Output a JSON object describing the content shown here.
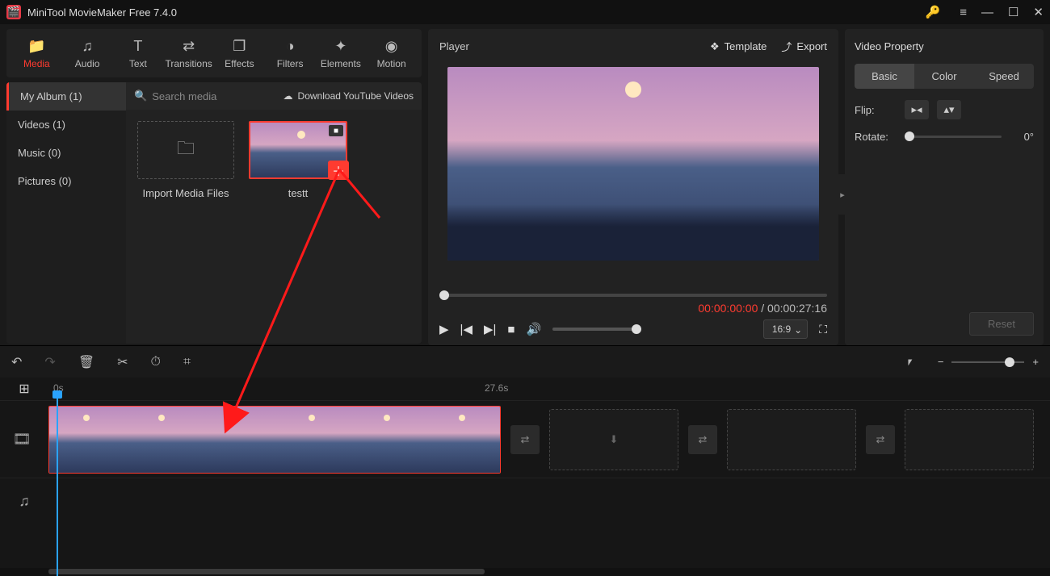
{
  "titlebar": {
    "title": "MiniTool MovieMaker Free 7.4.0"
  },
  "ribbon": [
    {
      "key": "media",
      "label": "Media",
      "glyph": "📁",
      "active": true
    },
    {
      "key": "audio",
      "label": "Audio",
      "glyph": "♫"
    },
    {
      "key": "text",
      "label": "Text",
      "glyph": "T"
    },
    {
      "key": "transitions",
      "label": "Transitions",
      "glyph": "⇄"
    },
    {
      "key": "effects",
      "label": "Effects",
      "glyph": "❐"
    },
    {
      "key": "filters",
      "label": "Filters",
      "glyph": "◑"
    },
    {
      "key": "elements",
      "label": "Elements",
      "glyph": "✦"
    },
    {
      "key": "motion",
      "label": "Motion",
      "glyph": "◉"
    }
  ],
  "media_nav": [
    {
      "label": "My Album (1)",
      "active": true
    },
    {
      "label": "Videos (1)"
    },
    {
      "label": "Music (0)"
    },
    {
      "label": "Pictures (0)"
    }
  ],
  "media_toolbar": {
    "search_placeholder": "Search media",
    "youtube_label": "Download YouTube Videos"
  },
  "import_label": "Import Media Files",
  "clip": {
    "name": "testt"
  },
  "player": {
    "title": "Player",
    "template_label": "Template",
    "export_label": "Export",
    "current_time": "00:00:00:00",
    "separator": " / ",
    "total_time": "00:00:27:16",
    "aspect_ratio": "16:9"
  },
  "props": {
    "title": "Video Property",
    "tabs": [
      "Basic",
      "Color",
      "Speed"
    ],
    "flip_label": "Flip:",
    "rotate_label": "Rotate:",
    "rotate_value": "0°",
    "reset_label": "Reset"
  },
  "timeline": {
    "ruler_start": "0s",
    "ruler_mark": "27.6s"
  }
}
